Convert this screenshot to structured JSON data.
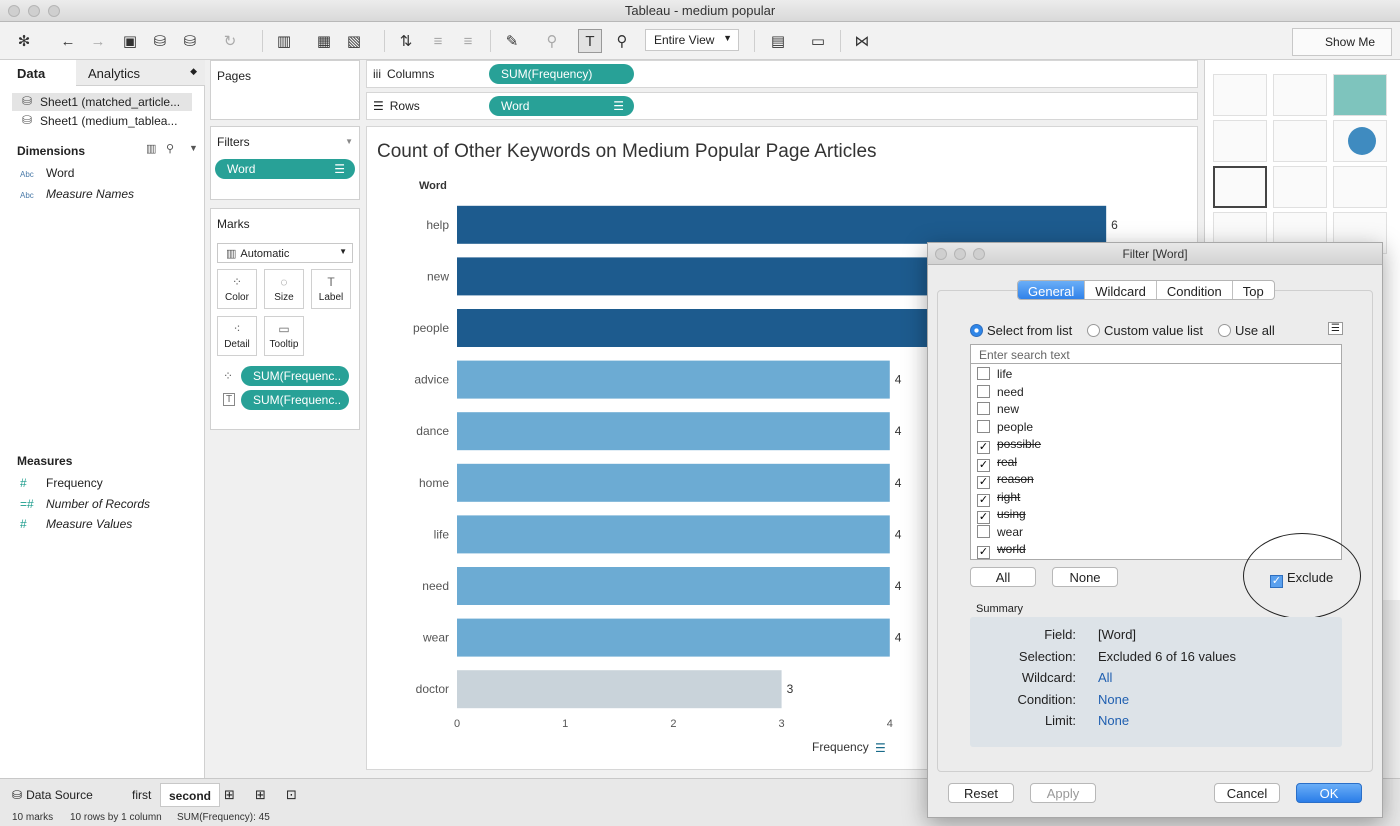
{
  "window": {
    "title": "Tableau - medium popular"
  },
  "toolbar": {
    "fit": "Entire View",
    "show_me": "Show Me"
  },
  "left": {
    "tabs": {
      "data": "Data",
      "analytics": "Analytics"
    },
    "sources": [
      "Sheet1 (matched_article...",
      "Sheet1 (medium_tablea..."
    ],
    "dimensions_title": "Dimensions",
    "dimensions": [
      {
        "type": "Abc",
        "name": "Word"
      },
      {
        "type": "Abc",
        "name": "Measure Names"
      }
    ],
    "measures_title": "Measures",
    "measures": [
      {
        "name": "Frequency"
      },
      {
        "name": "Number of Records"
      },
      {
        "name": "Measure Values"
      }
    ]
  },
  "cards": {
    "pages": "Pages",
    "filters": "Filters",
    "filter_pill": "Word",
    "marks": "Marks",
    "mark_type": "Automatic",
    "mark_buttons": [
      "Color",
      "Size",
      "Label",
      "Detail",
      "Tooltip"
    ],
    "mark_pills": [
      "SUM(Frequenc..",
      "SUM(Frequenc.."
    ]
  },
  "shelves": {
    "columns_label": "Columns",
    "columns_pill": "SUM(Frequency)",
    "rows_label": "Rows",
    "rows_pill": "Word"
  },
  "chart_data": {
    "type": "bar",
    "orientation": "horizontal",
    "title": "Count of Other Keywords on Medium Popular Page Articles",
    "ylabel": "Word",
    "xlabel": "Frequency",
    "categories": [
      "help",
      "new",
      "people",
      "advice",
      "dance",
      "home",
      "life",
      "need",
      "wear",
      "doctor"
    ],
    "values": [
      6,
      6,
      6,
      4,
      4,
      4,
      4,
      4,
      4,
      3
    ],
    "colors": [
      "#1d5b8e",
      "#1d5b8e",
      "#1d5b8e",
      "#6cabd3",
      "#6cabd3",
      "#6cabd3",
      "#6cabd3",
      "#6cabd3",
      "#6cabd3",
      "#c9d3da"
    ],
    "xticks": [
      0,
      1,
      2,
      3,
      4
    ],
    "xlim": [
      0,
      6.1
    ],
    "grid": false
  },
  "bottom": {
    "tabs": [
      "Data Source",
      "first",
      "second"
    ],
    "status": [
      "10 marks",
      "10 rows by 1 column",
      "SUM(Frequency): 45"
    ]
  },
  "dialog": {
    "title": "Filter [Word]",
    "tabs": [
      "General",
      "Wildcard",
      "Condition",
      "Top"
    ],
    "radios": [
      "Select from list",
      "Custom value list",
      "Use all"
    ],
    "search_placeholder": "Enter search text",
    "items": [
      {
        "label": "life",
        "checked": false
      },
      {
        "label": "need",
        "checked": false
      },
      {
        "label": "new",
        "checked": false
      },
      {
        "label": "people",
        "checked": false
      },
      {
        "label": "possible",
        "checked": true
      },
      {
        "label": "real",
        "checked": true
      },
      {
        "label": "reason",
        "checked": true
      },
      {
        "label": "right",
        "checked": true
      },
      {
        "label": "using",
        "checked": true
      },
      {
        "label": "wear",
        "checked": false
      },
      {
        "label": "world",
        "checked": true
      }
    ],
    "all_btn": "All",
    "none_btn": "None",
    "exclude_label": "Exclude",
    "summary_title": "Summary",
    "summary": [
      {
        "k": "Field:",
        "v": "[Word]",
        "link": false
      },
      {
        "k": "Selection:",
        "v": "Excluded 6 of 16 values",
        "link": false
      },
      {
        "k": "Wildcard:",
        "v": "All",
        "link": true
      },
      {
        "k": "Condition:",
        "v": "None",
        "link": true
      },
      {
        "k": "Limit:",
        "v": "None",
        "link": true
      }
    ],
    "buttons": {
      "reset": "Reset",
      "apply": "Apply",
      "cancel": "Cancel",
      "ok": "OK"
    }
  }
}
